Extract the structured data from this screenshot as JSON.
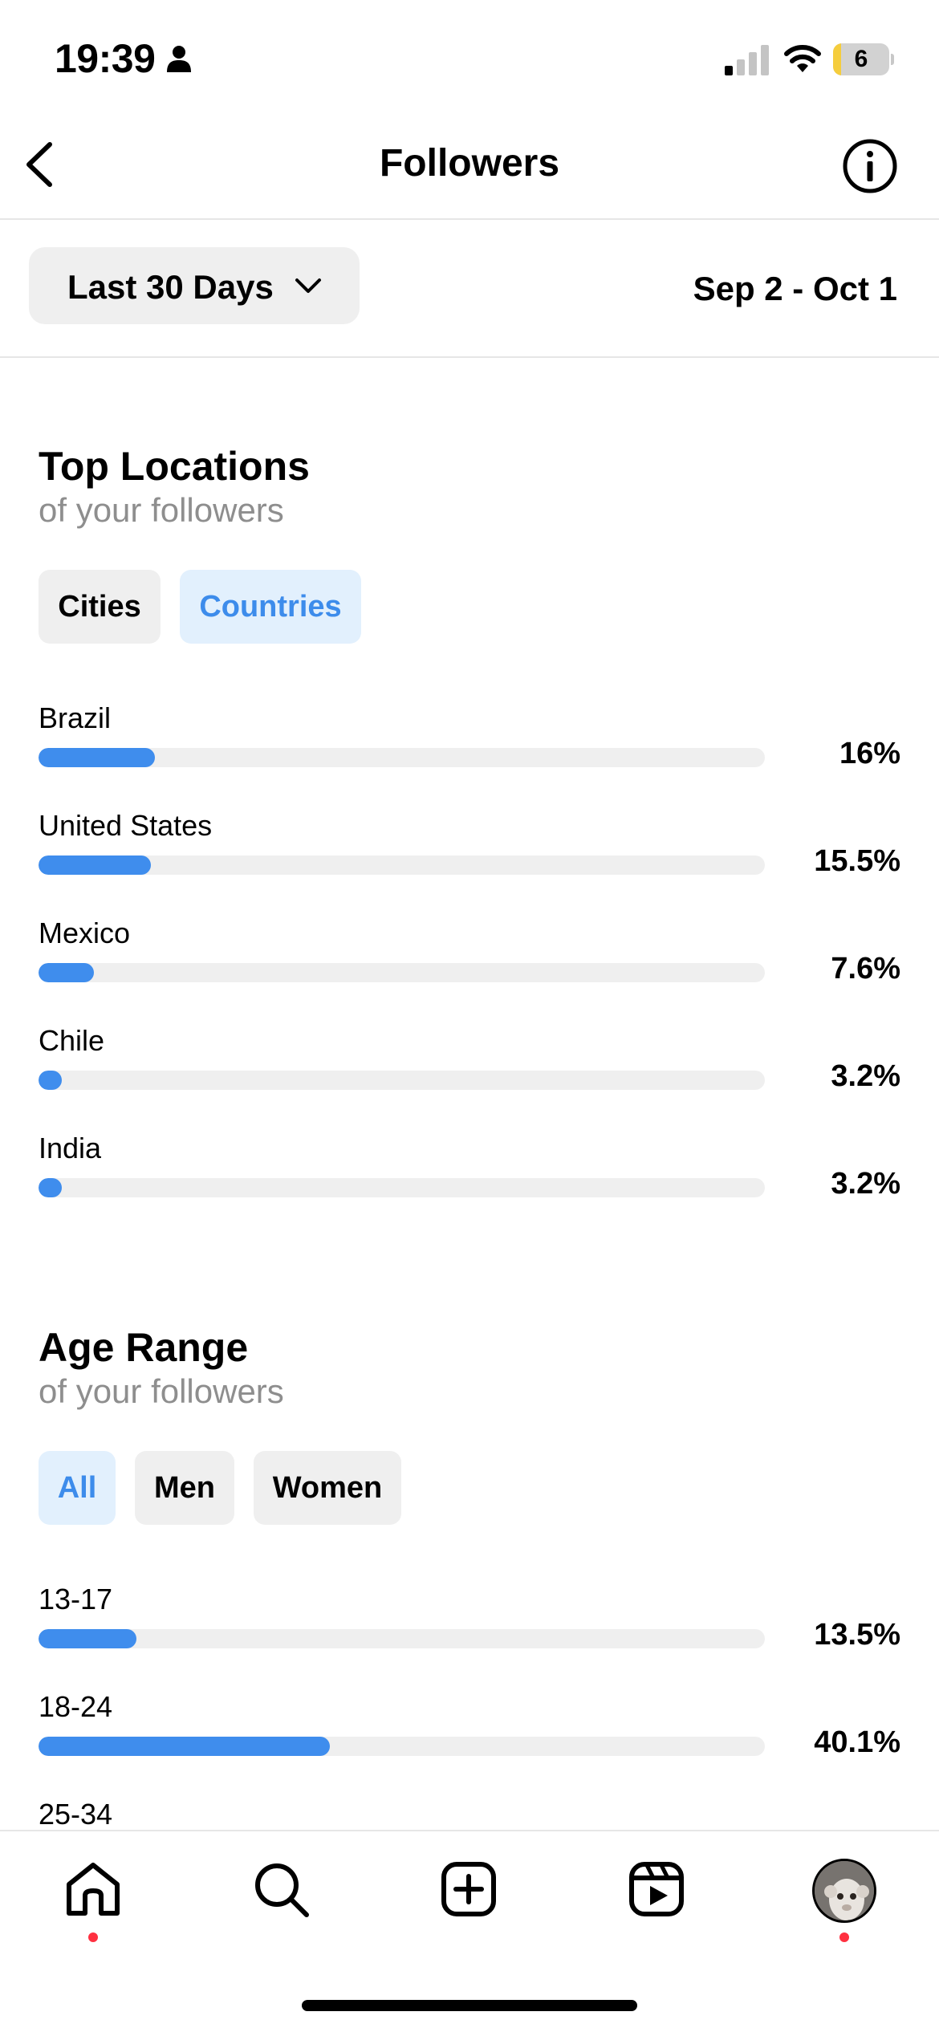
{
  "status_bar": {
    "time": "19:39",
    "battery_level": "6",
    "icons": [
      "person-icon",
      "signal-icon",
      "wifi-icon",
      "battery-icon"
    ]
  },
  "header": {
    "title": "Followers",
    "back_icon": "chevron-left-icon",
    "info_icon": "info-icon"
  },
  "filter": {
    "dropdown_label": "Last 30 Days",
    "date_range": "Sep 2 - Oct 1"
  },
  "top_locations": {
    "title": "Top Locations",
    "subtitle": "of your followers",
    "tabs": [
      {
        "label": "Cities",
        "active": false
      },
      {
        "label": "Countries",
        "active": true
      }
    ],
    "items": [
      {
        "label": "Brazil",
        "value": "16%",
        "percent": 16
      },
      {
        "label": "United States",
        "value": "15.5%",
        "percent": 15.5
      },
      {
        "label": "Mexico",
        "value": "7.6%",
        "percent": 7.6
      },
      {
        "label": "Chile",
        "value": "3.2%",
        "percent": 3.2
      },
      {
        "label": "India",
        "value": "3.2%",
        "percent": 3.2
      }
    ]
  },
  "age_range": {
    "title": "Age Range",
    "subtitle": "of your followers",
    "tabs": [
      {
        "label": "All",
        "active": true
      },
      {
        "label": "Men",
        "active": false
      },
      {
        "label": "Women",
        "active": false
      }
    ],
    "items": [
      {
        "label": "13-17",
        "value": "13.5%",
        "percent": 13.5
      },
      {
        "label": "18-24",
        "value": "40.1%",
        "percent": 40.1
      },
      {
        "label": "25-34",
        "value": "",
        "percent": null
      }
    ]
  },
  "tab_bar": {
    "items": [
      {
        "name": "home",
        "icon": "home-icon",
        "has_notification": true
      },
      {
        "name": "search",
        "icon": "search-icon",
        "has_notification": false
      },
      {
        "name": "create",
        "icon": "add-post-icon",
        "has_notification": false
      },
      {
        "name": "reels",
        "icon": "reels-icon",
        "has_notification": false
      },
      {
        "name": "profile",
        "icon": "profile-avatar",
        "has_notification": true
      }
    ]
  },
  "colors": {
    "accent": "#3f8ded",
    "active_chip_bg": "#e2f0fd",
    "track": "#efefef",
    "notification": "#ff3040"
  }
}
